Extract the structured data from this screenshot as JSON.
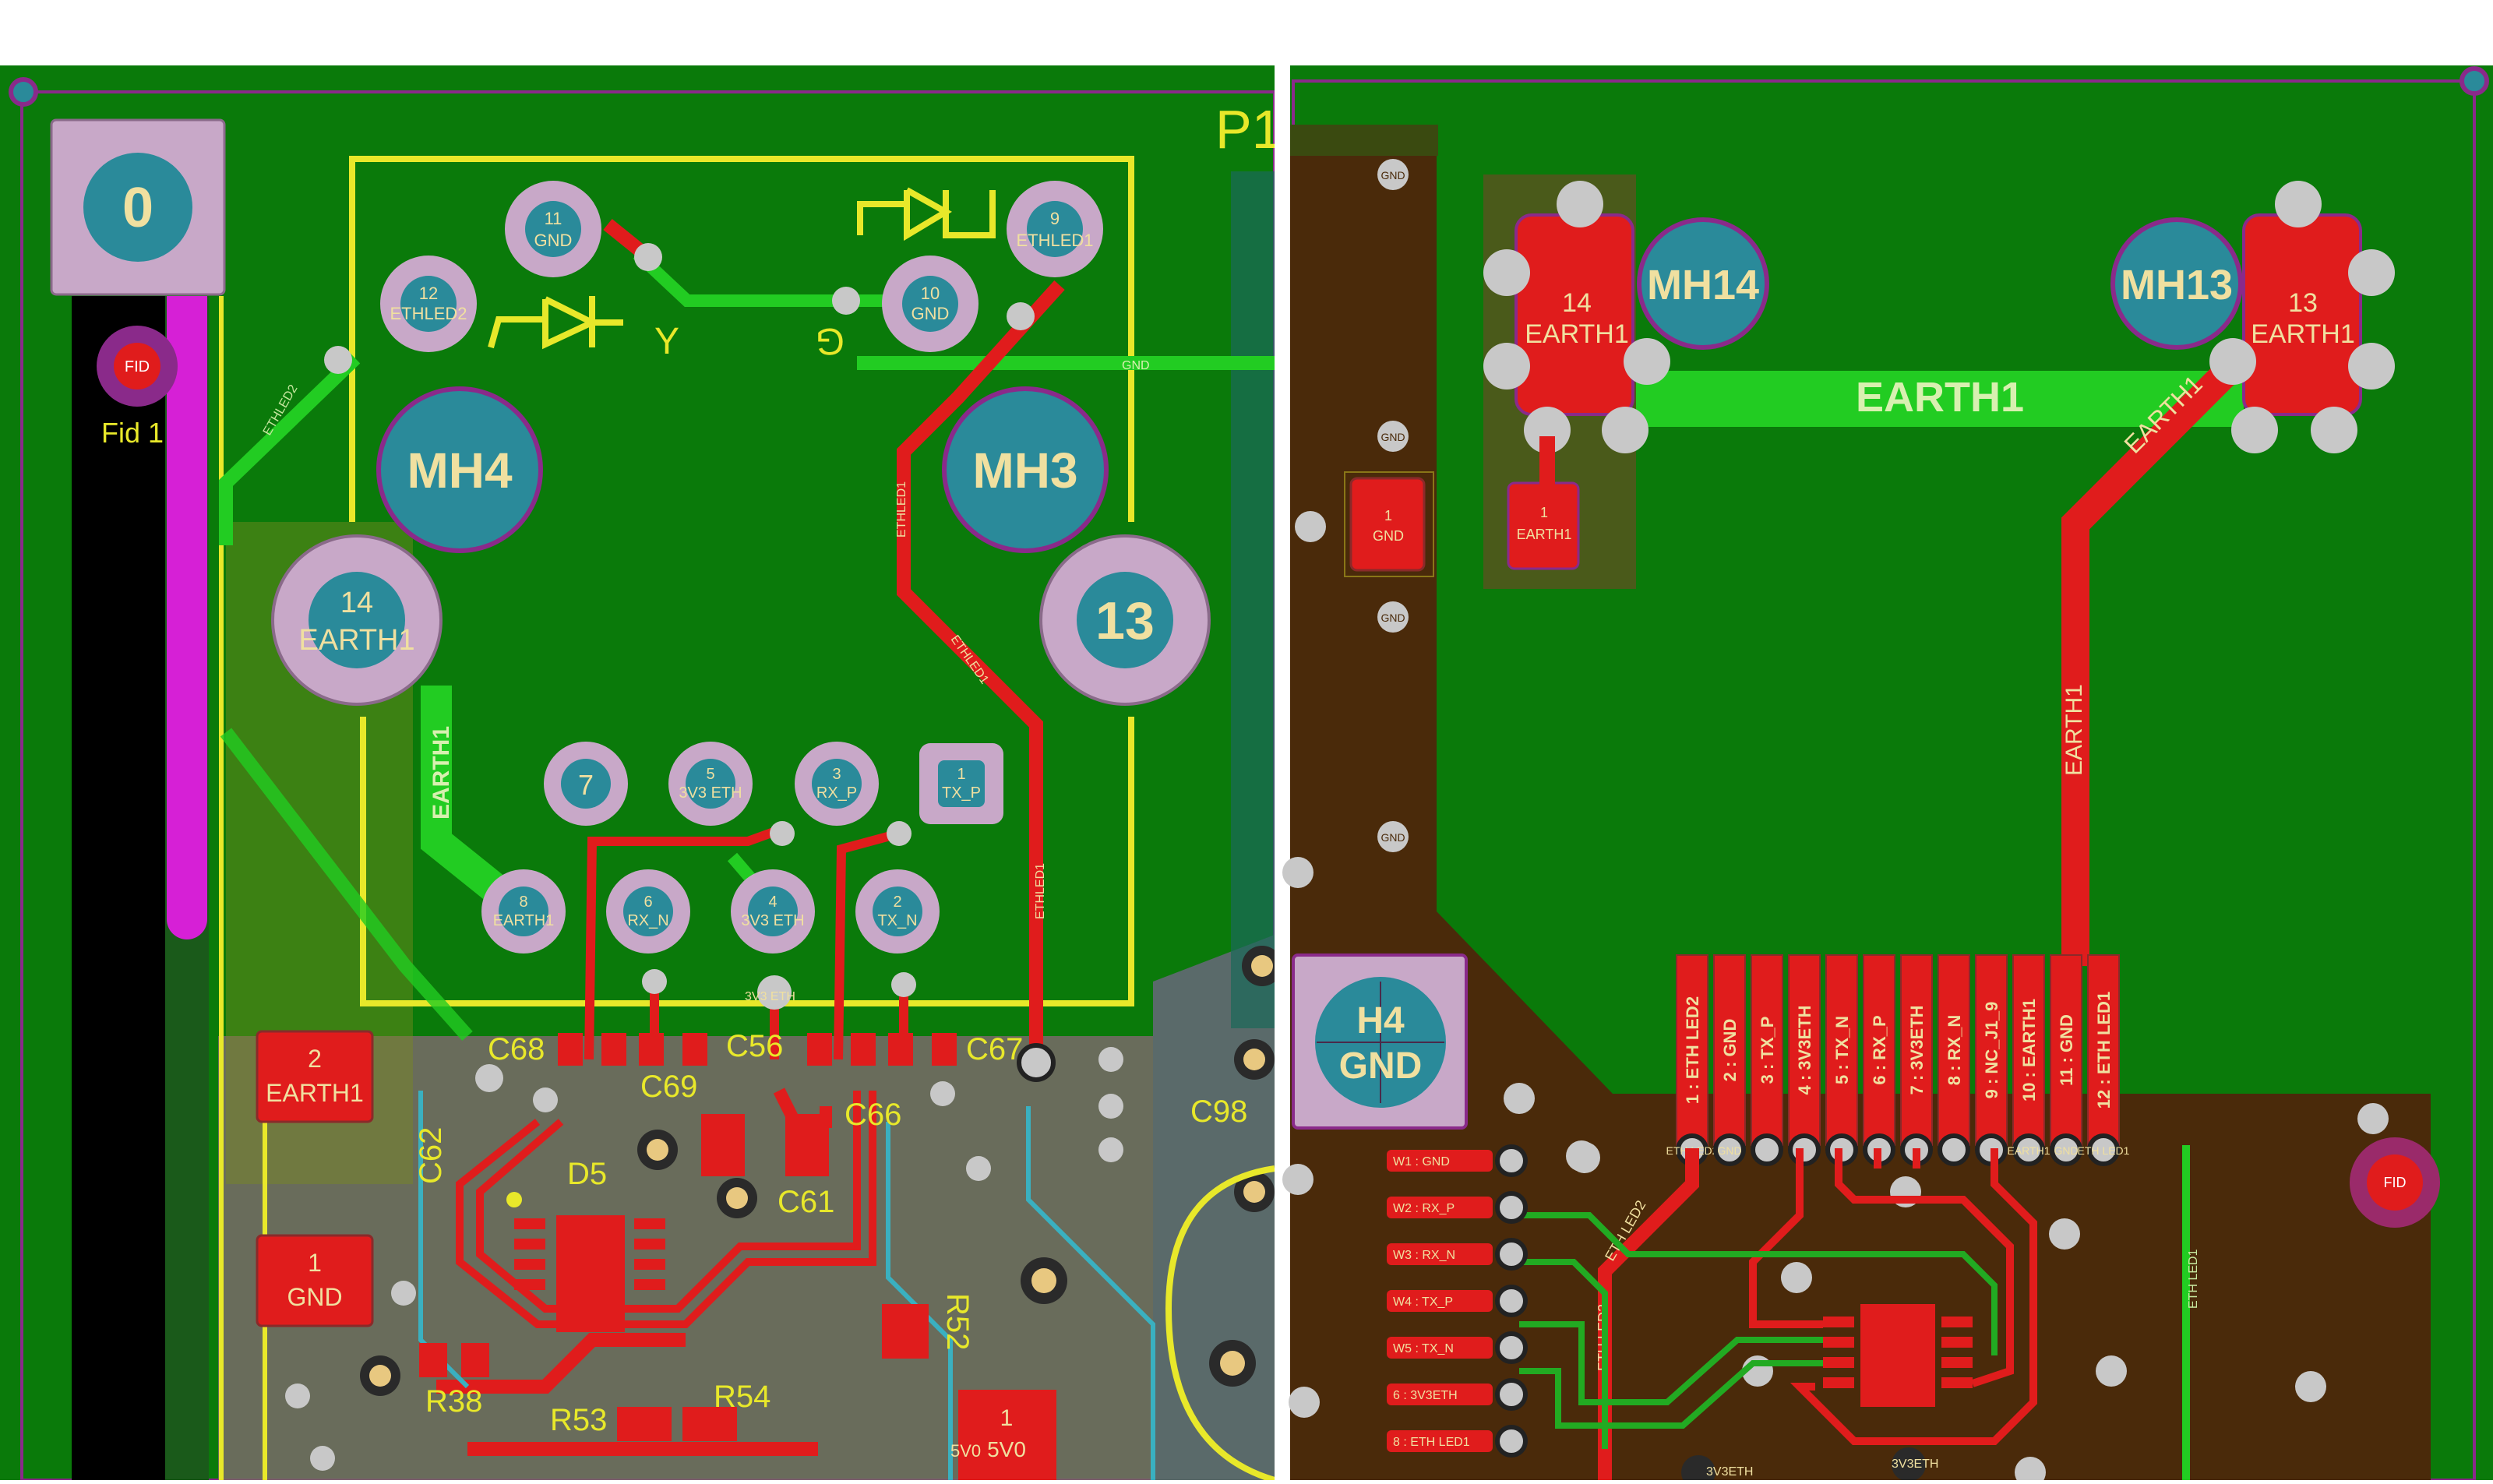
{
  "colors": {
    "board": "#0a7a0a",
    "copper_top": "#e01c1c",
    "silk": "#e8e82a",
    "pad": "#c8a8c8",
    "drill": "#2a8a9a",
    "plane": "#4a2a0a",
    "earth_trace": "#22cc22",
    "outline": "#8a2a8a",
    "pin_tag": "#a01818"
  },
  "left": {
    "mounting_pads": {
      "fid": "0",
      "mh4": "MH4",
      "mh3": "MH3",
      "p13": "13",
      "p14_num": "14",
      "p14_net": "EARTH1"
    },
    "connector_pins": {
      "p11_num": "11",
      "p11_net": "GND",
      "p12_num": "12",
      "p12_net": "ETHLED2",
      "p10_num": "10",
      "p10_net": "GND",
      "p9_num": "9",
      "p9_net": "ETHLED1",
      "p7_num": "7",
      "p5_num": "5",
      "p5_net": "3V3 ETH",
      "p3_num": "3",
      "p3_net": "RX_P",
      "p1_num": "1",
      "p1_net": "TX_P",
      "p8_num": "8",
      "p8_net": "EARTH1",
      "p6_num": "6",
      "p6_net": "RX_N",
      "p4_num": "4",
      "p4_net": "3V3 ETH",
      "p2_num": "2",
      "p2_net": "TX_N"
    },
    "fiducial": {
      "pad": "FID",
      "label": "Fid 1"
    },
    "designators": [
      "C68",
      "C56",
      "C67",
      "C69",
      "C66",
      "D5",
      "C61",
      "C62",
      "R38",
      "R53",
      "R54",
      "R52",
      "C98",
      "P1"
    ],
    "smd": {
      "earth1_num": "2",
      "earth1_net": "EARTH1",
      "gnd_num": "1",
      "gnd_net": "GND",
      "v5_num": "1",
      "v5_net": "5V0"
    },
    "trace_labels": {
      "ethled2": "ETHLED2",
      "ethled1": "ETHLED1",
      "earth1": "EARTH1",
      "gnd": "GND",
      "v33": "3V3 ETH",
      "v5": "5V0"
    }
  },
  "right": {
    "mh14": "MH14",
    "mh13": "MH13",
    "pad14_num": "14",
    "pad14_net": "EARTH1",
    "pad13_num": "13",
    "pad13_net": "EARTH1",
    "earth_trace_label": "EARTH1",
    "h4_name": "H4",
    "h4_net": "GND",
    "fid": "FID",
    "small_gnd_num": "1",
    "small_gnd_net": "GND",
    "small_earth_num": "1",
    "small_earth_net": "EARTH1",
    "via_label": "GND",
    "connector_pins": [
      "1 : ETH LED2",
      "2 : GND",
      "3 : TX_P",
      "4 : 3V3ETH",
      "5 : TX_N",
      "6 : RX_P",
      "7 : 3V3ETH",
      "8 : RX_N",
      "9 : NC_J1_9",
      "10 : EARTH1",
      "11 : GND",
      "12 : ETH LED1"
    ],
    "pin_net_tags": [
      "ETH LED2",
      "GND",
      "",
      "",
      "",
      "",
      "",
      "",
      "",
      "EARTH1",
      "GND",
      "ETH LED1"
    ],
    "wire_pads": [
      "W1 : GND",
      "W2 : RX_P",
      "W3 : RX_N",
      "W4 : TX_P",
      "W5 : TX_N",
      "6 : 3V3ETH",
      "8 : ETH LED1"
    ],
    "trace_labels": {
      "ethled2": "ETH LED2",
      "ethled1": "ETH LED1",
      "v33": "3V3ETH"
    }
  }
}
